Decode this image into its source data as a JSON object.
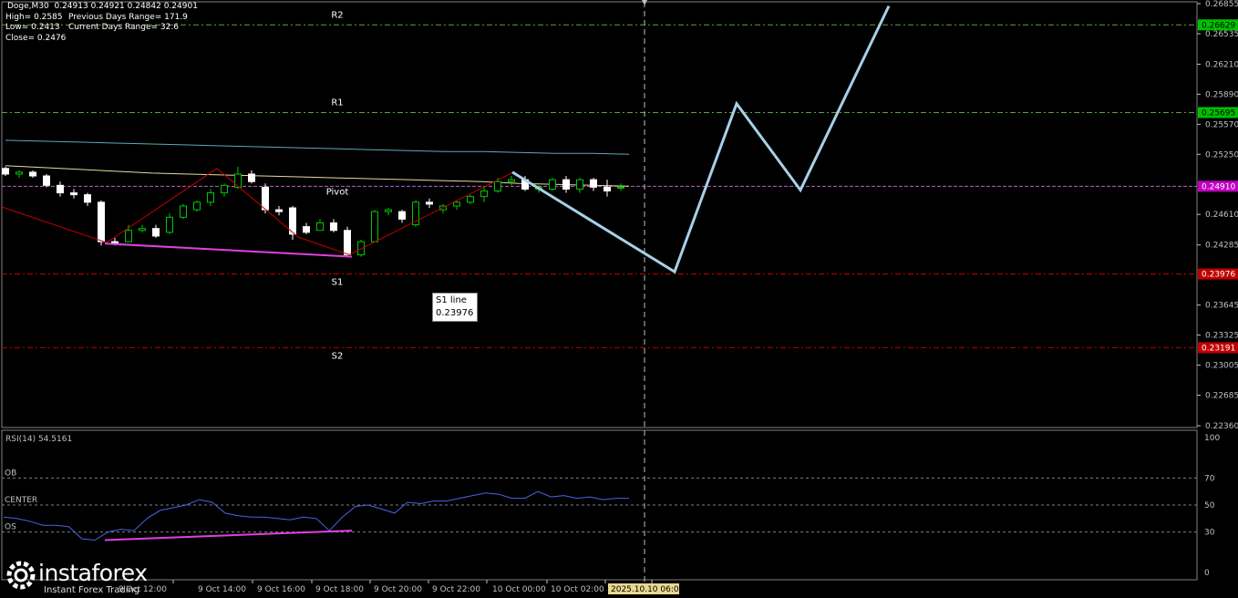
{
  "header": {
    "symbol_line": "Doge,M30  0.24913 0.24921 0.24842 0.24901",
    "high": "High= 0.2585",
    "prev_range": "Previous Days Range= 171.9",
    "low": "Low= 0.2413",
    "current_range": "Current Days Range= 32.6",
    "close": "Close= 0.2476"
  },
  "tooltip": {
    "title": "S1 line",
    "value": "0.23976"
  },
  "logo": {
    "brand": "instaforex",
    "tagline": "Instant Forex Trading"
  },
  "colors": {
    "background": "#000000",
    "bull": "#00c800",
    "bear": "#ffffff",
    "ma_fast": "#e8d8a0",
    "ma_slow": "#5fa8b8",
    "pivot": "#c060c0",
    "resistance": "#60a040",
    "support": "#c00000",
    "forecast": "#a8d0e8",
    "rsi": "#4a64e6",
    "divergence": "#e040e0",
    "wedge": "#c00000"
  },
  "chart_data": [
    {
      "type": "candlestick",
      "symbol": "Doge",
      "timeframe": "M30",
      "price_axis": {
        "ylim": [
          0.2236,
          0.26855
        ],
        "ticks": [
          "0.26855",
          "0.26535",
          "0.26210",
          "0.25890",
          "0.25570",
          "0.25250",
          "0.24610",
          "0.24285",
          "0.23645",
          "0.23325",
          "0.23005",
          "0.22685",
          "0.22360"
        ]
      },
      "levels": [
        {
          "name": "R2",
          "value": 0.26629,
          "label": "0.26629",
          "tag_color": "#00c000",
          "line": "resistance"
        },
        {
          "name": "R1",
          "value": 0.25695,
          "label": "0.25695",
          "tag_color": "#00c000",
          "line": "resistance"
        },
        {
          "name": "Pivot",
          "value": 0.2491,
          "label": "0.24910",
          "tag_color": "#c000c0",
          "line": "pivot"
        },
        {
          "name": "S1",
          "value": 0.23976,
          "label": "0.23976",
          "tag_color": "#c00000",
          "line": "support"
        },
        {
          "name": "S2",
          "value": 0.23191,
          "label": "0.23191",
          "tag_color": "#c00000",
          "line": "support"
        }
      ],
      "candles": [
        [
          0.251,
          0.2512,
          0.2502,
          0.2504
        ],
        [
          0.2504,
          0.2508,
          0.25,
          0.2506
        ],
        [
          0.2506,
          0.2508,
          0.25,
          0.2502
        ],
        [
          0.2502,
          0.2504,
          0.249,
          0.2492
        ],
        [
          0.2492,
          0.2496,
          0.248,
          0.2484
        ],
        [
          0.2484,
          0.2488,
          0.2478,
          0.2482
        ],
        [
          0.2482,
          0.2484,
          0.247,
          0.2474
        ],
        [
          0.2474,
          0.2476,
          0.2428,
          0.2432
        ],
        [
          0.2432,
          0.2436,
          0.2428,
          0.243
        ],
        [
          0.2432,
          0.245,
          0.2432,
          0.2444
        ],
        [
          0.2444,
          0.245,
          0.2442,
          0.2446
        ],
        [
          0.2446,
          0.245,
          0.2436,
          0.2438
        ],
        [
          0.2442,
          0.2462,
          0.244,
          0.2458
        ],
        [
          0.2458,
          0.2472,
          0.2456,
          0.247
        ],
        [
          0.2466,
          0.2476,
          0.2464,
          0.2474
        ],
        [
          0.2474,
          0.2488,
          0.247,
          0.2484
        ],
        [
          0.2484,
          0.2494,
          0.248,
          0.2492
        ],
        [
          0.249,
          0.2512,
          0.2488,
          0.2504
        ],
        [
          0.2504,
          0.2508,
          0.2494,
          0.2496
        ],
        [
          0.249,
          0.2494,
          0.2462,
          0.2466
        ],
        [
          0.2466,
          0.247,
          0.246,
          0.2464
        ],
        [
          0.2468,
          0.247,
          0.2434,
          0.244
        ],
        [
          0.2448,
          0.2452,
          0.244,
          0.2442
        ],
        [
          0.2444,
          0.2456,
          0.2444,
          0.2452
        ],
        [
          0.2452,
          0.2456,
          0.2442,
          0.2444
        ],
        [
          0.2444,
          0.2448,
          0.2416,
          0.2418
        ],
        [
          0.2418,
          0.2434,
          0.2416,
          0.2432
        ],
        [
          0.2432,
          0.2466,
          0.2432,
          0.2464
        ],
        [
          0.2464,
          0.2468,
          0.246,
          0.2466
        ],
        [
          0.2464,
          0.2466,
          0.2452,
          0.2456
        ],
        [
          0.245,
          0.2476,
          0.2448,
          0.2474
        ],
        [
          0.2474,
          0.2478,
          0.2468,
          0.2472
        ],
        [
          0.2466,
          0.2472,
          0.2462,
          0.247
        ],
        [
          0.247,
          0.2476,
          0.2466,
          0.2474
        ],
        [
          0.2474,
          0.2482,
          0.2472,
          0.248
        ],
        [
          0.248,
          0.249,
          0.2474,
          0.2486
        ],
        [
          0.2486,
          0.25,
          0.2484,
          0.2496
        ],
        [
          0.2496,
          0.2502,
          0.2492,
          0.2498
        ],
        [
          0.2498,
          0.2502,
          0.2486,
          0.2488
        ],
        [
          0.2488,
          0.2492,
          0.2484,
          0.249
        ],
        [
          0.2488,
          0.25,
          0.2486,
          0.2498
        ],
        [
          0.2498,
          0.2502,
          0.2484,
          0.2488
        ],
        [
          0.2488,
          0.25,
          0.2484,
          0.2498
        ],
        [
          0.2498,
          0.25,
          0.2486,
          0.249
        ],
        [
          0.249,
          0.2498,
          0.248,
          0.2486
        ],
        [
          0.249,
          0.2494,
          0.2486,
          0.249
        ]
      ],
      "ma_fast": [
        0.2513,
        0.2511,
        0.2509,
        0.2507,
        0.2505,
        0.2504,
        0.2503,
        0.2502,
        0.2501,
        0.25,
        0.2499,
        0.2498,
        0.2497,
        0.2496,
        0.2494,
        0.2493,
        0.2492,
        0.2491
      ],
      "ma_slow": [
        0.254,
        0.2539,
        0.2538,
        0.2537,
        0.2536,
        0.2535,
        0.2534,
        0.2533,
        0.2532,
        0.2531,
        0.253,
        0.2529,
        0.2528,
        0.2528,
        0.2527,
        0.2526,
        0.2526,
        0.2525
      ],
      "forecast_path": [
        0.2506,
        0.24,
        0.2579,
        0.2487,
        0.2683
      ],
      "labels_text": {
        "R2": "R2",
        "R1": "R1",
        "Pivot": "Pivot",
        "S1": "S1",
        "S2": "S2"
      }
    },
    {
      "type": "line",
      "title": "RSI(14) 54.5161",
      "ylim": [
        0,
        100
      ],
      "ticks": [
        "100",
        "70",
        "50",
        "30",
        "0"
      ],
      "levels": [
        {
          "name": "OB",
          "value": 70
        },
        {
          "name": "CENTER",
          "value": 50
        },
        {
          "name": "OS",
          "value": 30
        }
      ],
      "values": [
        41,
        40,
        38,
        35,
        35,
        34,
        25,
        24,
        30,
        32,
        31,
        40,
        46,
        48,
        50,
        54,
        52,
        44,
        42,
        41,
        41,
        40,
        39,
        41,
        40,
        31,
        41,
        49,
        50,
        47,
        44,
        52,
        51,
        53,
        53,
        55,
        57,
        59,
        58,
        55,
        55,
        60,
        56,
        57,
        55,
        56,
        54,
        55,
        55
      ],
      "x_labels": [
        "9 Oct 12:00",
        "9 Oct 14:00",
        "9 Oct 16:00",
        "9 Oct 18:00",
        "9 Oct 20:00",
        "9 Oct 22:00",
        "10 Oct 00:00",
        "10 Oct 02:00",
        "10 Oc"
      ],
      "cursor_time": "2025.10.10 06:00"
    }
  ]
}
